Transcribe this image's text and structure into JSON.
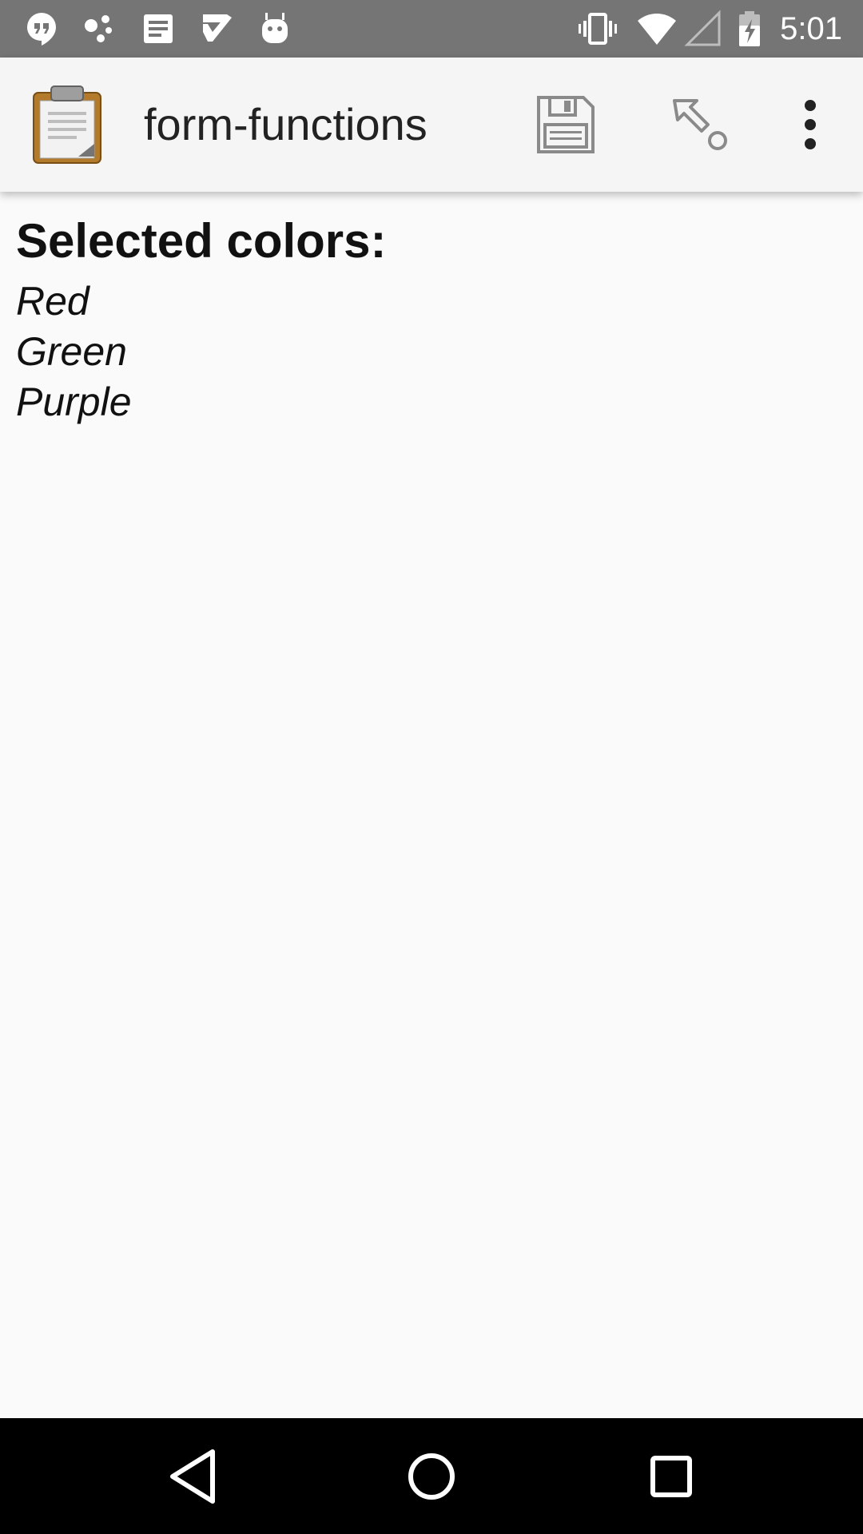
{
  "status_bar": {
    "time": "5:01",
    "left_icons": [
      "hangouts-icon",
      "share-icon",
      "document-icon",
      "tasks-icon",
      "android-icon"
    ],
    "right_icons": [
      "vibrate-icon",
      "wifi-icon",
      "signal-icon",
      "battery-charging-icon"
    ]
  },
  "app_bar": {
    "title": "form-functions",
    "logo_icon": "clipboard-icon",
    "actions": [
      "save-icon",
      "jump-icon",
      "more-vert-icon"
    ]
  },
  "content": {
    "heading": "Selected colors:",
    "colors": [
      "Red",
      "Green",
      "Purple"
    ]
  },
  "nav_bar": {
    "buttons": [
      "back-icon",
      "home-icon",
      "recents-icon"
    ]
  },
  "theme": {
    "status_bar_bg": "#757575",
    "app_bar_bg": "#f5f5f5",
    "page_bg": "#fafafa",
    "nav_bar_bg": "#000000"
  }
}
